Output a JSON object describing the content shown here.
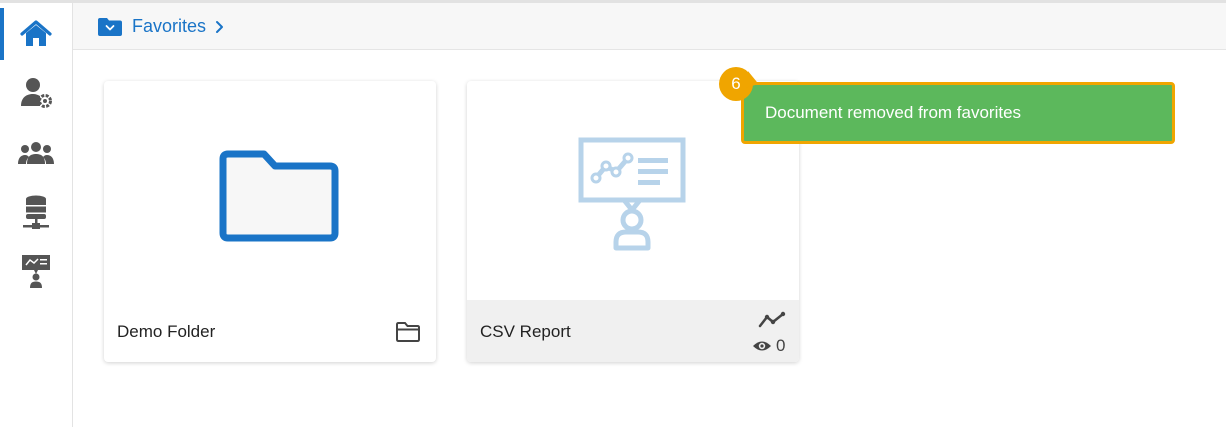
{
  "sidebar": {
    "items": [
      {
        "name": "home",
        "icon": "home-icon",
        "active": true
      },
      {
        "name": "user-settings",
        "icon": "user-gear-icon",
        "active": false
      },
      {
        "name": "groups",
        "icon": "users-group-icon",
        "active": false
      },
      {
        "name": "data-connectors",
        "icon": "database-network-icon",
        "active": false
      },
      {
        "name": "presentation",
        "icon": "presentation-user-icon",
        "active": false
      }
    ]
  },
  "breadcrumb": {
    "icon": "folder-dropdown-icon",
    "label": "Favorites"
  },
  "cards": [
    {
      "title": "Demo Folder",
      "type": "folder",
      "type_icon": "folder-outline-icon"
    },
    {
      "title": "CSV Report",
      "type": "report",
      "type_icon": "line-chart-icon",
      "views": "0"
    }
  ],
  "toast": {
    "message": "Document removed from favorites",
    "step": "6"
  },
  "colors": {
    "accent": "#1a74c7",
    "toast_bg": "#5cb85c",
    "highlight": "#f0a500",
    "icon_gray": "#555555",
    "thumbnail_blue": "#b7d3ea"
  }
}
